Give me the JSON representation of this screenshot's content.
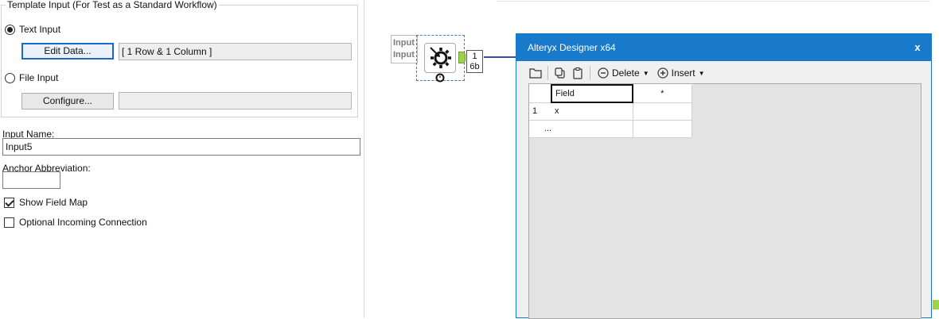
{
  "config": {
    "group_title": "Template Input (For Test as a Standard Workflow)",
    "text_input_label": "Text Input",
    "edit_data_label": "Edit Data...",
    "summary_value": "[ 1 Row & 1 Column ]",
    "file_input_label": "File Input",
    "configure_label": "Configure...",
    "file_value": "",
    "input_name_label": "Input Name:",
    "input_name_value": "Input5",
    "anchor_label": "Anchor Abbreviation:",
    "anchor_value": "",
    "show_field_map_label": "Show Field Map",
    "show_field_map_checked": true,
    "optional_incoming_label": "Optional Incoming Connection",
    "optional_incoming_checked": false,
    "selected_input": "text"
  },
  "canvas": {
    "node_label_line1": "Input",
    "node_label_line2": "Input",
    "node_icon": "macro-input-gear-icon",
    "counter_line1": "1",
    "counter_line2": "6b",
    "connection_color": "#3d4aa8",
    "anchor_color": "#9ed24b"
  },
  "dialog": {
    "title": "Alteryx Designer x64",
    "close_glyph": "x",
    "titlebar_color": "#1979ca",
    "toolbar": {
      "open_icon": "folder-icon",
      "copy_icon": "copy-icon",
      "paste_icon": "clipboard-icon",
      "delete_label": "Delete",
      "insert_label": "Insert"
    },
    "grid": {
      "headers": [
        "Field",
        "*"
      ],
      "rows": [
        {
          "row_label": "1",
          "cells": [
            "x",
            ""
          ]
        }
      ],
      "new_row_marker": "..."
    }
  }
}
